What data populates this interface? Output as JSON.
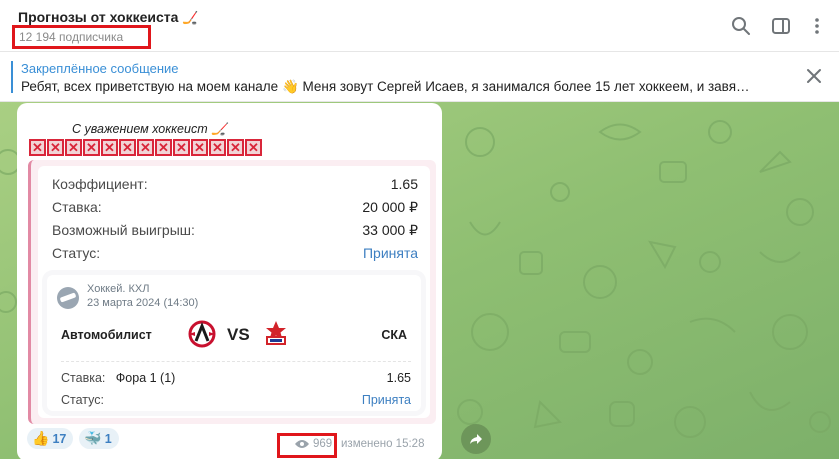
{
  "header": {
    "title": "Прогнозы от хоккеиста",
    "subscribers": "12 194 подписчика"
  },
  "pinned": {
    "title": "Закреплённое сообщение",
    "text": "Ребят, всех приветствую на моем канале 👋      Меня зовут Сергей Исаев, я занимался более 15 лет хоккеем, и завя…"
  },
  "message": {
    "signature": "С уважением хоккеист",
    "x_marks": [
      "✕",
      "✕",
      "✕",
      "✕",
      "✕",
      "✕",
      "✕",
      "✕",
      "✕",
      "✕",
      "✕",
      "✕",
      "✕"
    ],
    "bet": {
      "coef_label": "Коэффициент:",
      "coef_value": "1.65",
      "stake_label": "Ставка:",
      "stake_value": "20 000 ₽",
      "win_label": "Возможный выигрыш:",
      "win_value": "33 000 ₽",
      "status_label": "Статус:",
      "status_value": "Принята"
    },
    "match": {
      "league": "Хоккей. КХЛ",
      "date": "23 марта 2024 (14:30)",
      "team_home": "Автомобилист",
      "vs": "VS",
      "team_away": "СКА",
      "stake_label": "Ставка:",
      "stake_value": "Фора 1 (1)",
      "stake_coef": "1.65",
      "status_label": "Статус:",
      "status_value": "Принята"
    },
    "reactions": [
      {
        "emoji": "👍",
        "count": "17"
      },
      {
        "emoji": "🐳",
        "count": "1"
      }
    ],
    "views": "969",
    "edited": "изменено 15:28"
  },
  "colors": {
    "accent": "#3a8fd6",
    "highlight": "#e0161b",
    "chat_bg": "#8fbf72"
  }
}
